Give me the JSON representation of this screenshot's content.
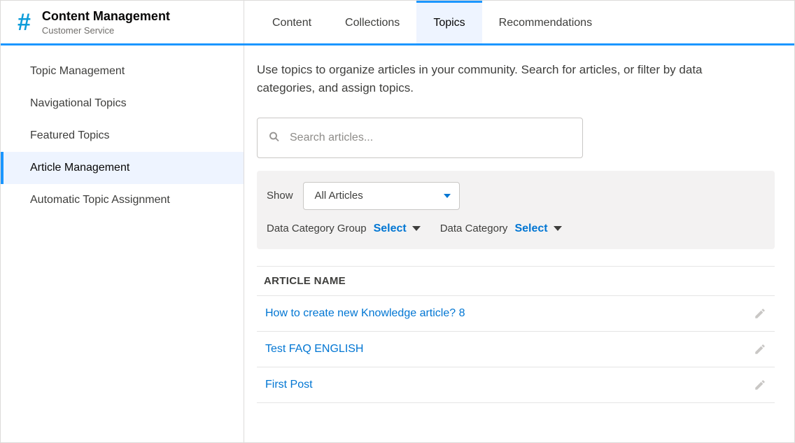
{
  "header": {
    "title": "Content Management",
    "subtitle": "Customer Service",
    "tabs": [
      {
        "label": "Content",
        "active": false
      },
      {
        "label": "Collections",
        "active": false
      },
      {
        "label": "Topics",
        "active": true
      },
      {
        "label": "Recommendations",
        "active": false
      }
    ]
  },
  "sidebar": {
    "items": [
      {
        "label": "Topic Management",
        "active": false
      },
      {
        "label": "Navigational Topics",
        "active": false
      },
      {
        "label": "Featured Topics",
        "active": false
      },
      {
        "label": "Article Management",
        "active": true
      },
      {
        "label": "Automatic Topic Assignment",
        "active": false
      }
    ]
  },
  "main": {
    "intro": "Use topics to organize articles in your community. Search for articles, or filter by data categories, and assign topics.",
    "search_placeholder": "Search articles...",
    "filters": {
      "show_label": "Show",
      "show_value": "All Articles",
      "dcg_label": "Data Category Group",
      "dcg_select": "Select",
      "dc_label": "Data Category",
      "dc_select": "Select"
    },
    "table": {
      "header": "ARTICLE NAME",
      "rows": [
        {
          "name": "How to create new Knowledge article? 8"
        },
        {
          "name": "Test FAQ ENGLISH"
        },
        {
          "name": "First Post"
        }
      ]
    }
  }
}
